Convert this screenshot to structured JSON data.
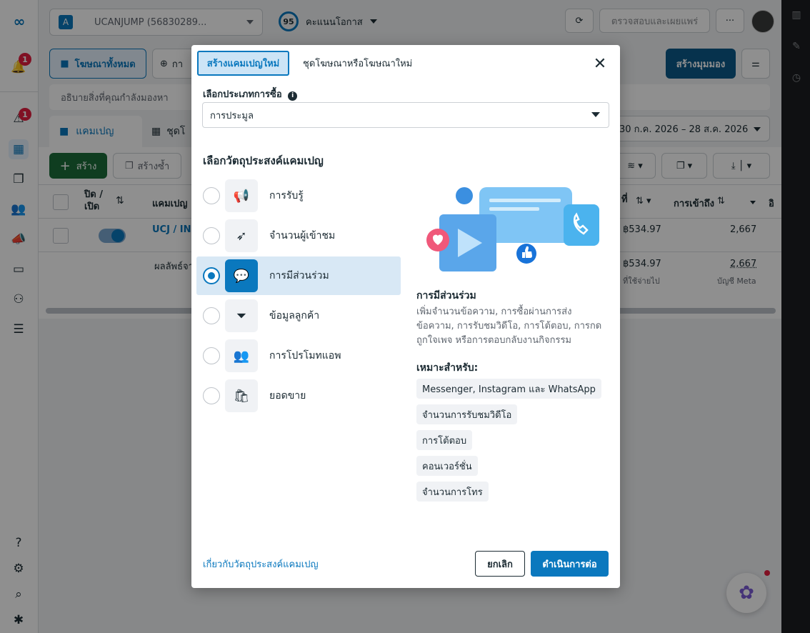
{
  "topbar": {
    "account_letter": "A",
    "account_name": "UCANJUMP (56830289...",
    "opportunity_score": "95",
    "opportunity_label": "คะแนนโอกาส",
    "review_publish": "ตรวจสอบและเผยแพร่",
    "more": "···"
  },
  "rail": {
    "notif_badge": "1",
    "alert_badge": "1",
    "help": "?"
  },
  "background": {
    "all_ads_btn": "โฆษณาทั้งหมด",
    "second_btn": "กา",
    "create_view": "สร้างมุมมอง",
    "search_placeholder": "อธิบายสิ่งที่คุณกำลังมองหา",
    "tab_campaign": "แคมเปญ",
    "tab_adset": "ชุดโ",
    "date_range": "30 ก.ค. 2026 – 28 ส.ค. 2026",
    "create_btn": "สร้าง",
    "duplicate_btn": "สร้างซ้ำ",
    "col_onoff": "ปิด / เปิด",
    "col_campaign": "แคมเปญ",
    "col_spend": "ที่",
    "col_reach": "การเข้าถึง",
    "col_more": "อิ",
    "row_name": "UCJ / IN",
    "row_spend": "฿534.97",
    "row_reach": "2,667",
    "total_label": "ผลลัพธ์จา",
    "total_spend": "฿534.97",
    "total_spend_sub": "ที่ใช้จ่ายไป",
    "total_reach": "2,667",
    "total_reach_sub": "บัญชี Meta"
  },
  "modal": {
    "tab_new_campaign": "สร้างแคมเปญใหม่",
    "tab_new_adset": "ชุดโฆษณาหรือโฆษณาใหม่",
    "buy_type_label": "เลือกประเภทการซื้อ",
    "buy_type_value": "การประมูล",
    "objective_label": "เลือกวัตถุประสงค์แคมเปญ",
    "objectives": [
      {
        "label": "การรับรู้",
        "icon": "megaphone-icon"
      },
      {
        "label": "จำนวนผู้เข้าชม",
        "icon": "cursor-icon"
      },
      {
        "label": "การมีส่วนร่วม",
        "icon": "chat-bubbles-icon",
        "selected": true
      },
      {
        "label": "ข้อมูลลูกค้า",
        "icon": "funnel-icon"
      },
      {
        "label": "การโปรโมทแอพ",
        "icon": "people-icon"
      },
      {
        "label": "ยอดขาย",
        "icon": "shopping-bag-icon"
      }
    ],
    "detail_title": "การมีส่วนร่วม",
    "detail_description": "เพิ่มจำนวนข้อความ, การซื้อผ่านการส่งข้อความ, การรับชมวิดีโอ, การโต้ตอบ, การกดถูกใจเพจ หรือการตอบกลับงานกิจกรรม",
    "good_for_label": "เหมาะสำหรับ:",
    "good_for": [
      "Messenger, Instagram และ WhatsApp",
      "จำนวนการรับชมวิดีโอ",
      "การโต้ตอบ",
      "คอนเวอร์ชั่น",
      "จำนวนการโทร"
    ],
    "about_link": "เกี่ยวกับวัตถุประสงค์แคมเปญ",
    "cancel": "ยกเลิก",
    "continue": "ดำเนินการต่อ"
  },
  "colors": {
    "accent": "#0a78be",
    "badge": "#e41e3f",
    "button_dark": "#0b5a8a"
  }
}
